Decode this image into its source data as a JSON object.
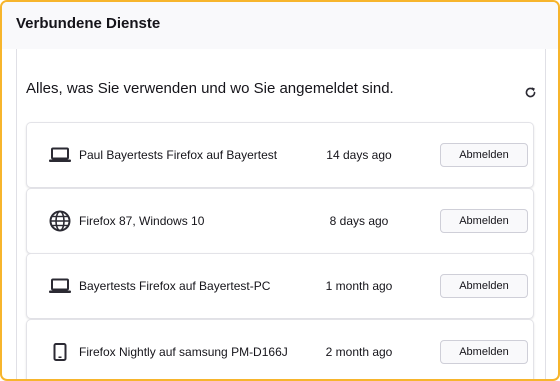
{
  "header": {
    "title": "Verbundene Dienste"
  },
  "main": {
    "subtitle": "Alles, was Sie verwenden und wo Sie angemeldet sind.",
    "refresh_icon": "refresh-icon"
  },
  "devices": [
    {
      "icon": "laptop-icon",
      "name": "Paul Bayertests Firefox auf Bayertest",
      "last_seen": "14 days ago",
      "action": "Abmelden"
    },
    {
      "icon": "globe-icon",
      "name": "Firefox 87, Windows 10",
      "last_seen": "8 days ago",
      "action": "Abmelden"
    },
    {
      "icon": "laptop-icon",
      "name": "Bayertests Firefox auf Bayertest-PC",
      "last_seen": "1 month ago",
      "action": "Abmelden"
    },
    {
      "icon": "tablet-icon",
      "name": "Firefox Nightly auf samsung PM-D166J",
      "last_seen": "2 month ago",
      "action": "Abmelden"
    }
  ],
  "colors": {
    "frame_border": "#f7b52c",
    "text": "#15141a",
    "icon": "#2b2a33"
  }
}
